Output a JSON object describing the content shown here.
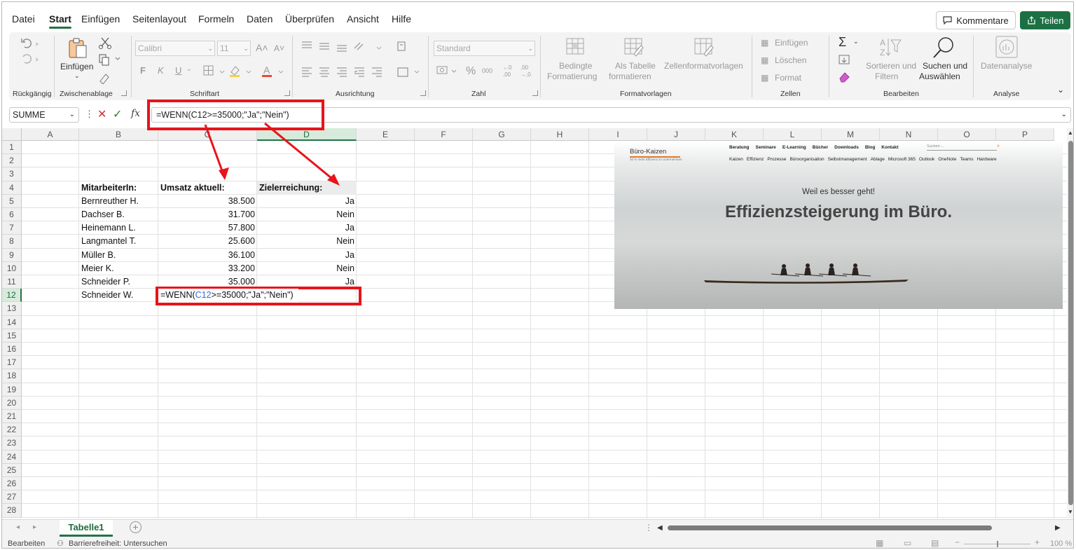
{
  "menu": {
    "tabs": [
      "Datei",
      "Start",
      "Einfügen",
      "Seitenlayout",
      "Formeln",
      "Daten",
      "Überprüfen",
      "Ansicht",
      "Hilfe"
    ],
    "active": "Start",
    "kommentare": "Kommentare",
    "teilen": "Teilen"
  },
  "ribbon": {
    "groups": {
      "undo": "Rückgängig",
      "clipboard": "Zwischenablage",
      "font": "Schriftart",
      "alignment": "Ausrichtung",
      "number": "Zahl",
      "styles": "Formatvorlagen",
      "cells": "Zellen",
      "editing": "Bearbeiten",
      "analysis": "Analyse"
    },
    "paste_label": "Einfügen",
    "font_name": "Calibri",
    "font_size": "11",
    "number_format": "Standard",
    "bold": "F",
    "italic": "K",
    "underline": "U",
    "cond_format_1": "Bedingte",
    "cond_format_2": "Formatierung",
    "as_table_1": "Als Tabelle",
    "as_table_2": "formatieren",
    "cell_styles": "Zellenformatvorlagen",
    "cells_insert": "Einfügen",
    "cells_delete": "Löschen",
    "cells_format": "Format",
    "sort_1": "Sortieren und",
    "sort_2": "Filtern",
    "find_1": "Suchen und",
    "find_2": "Auswählen",
    "analyze": "Datenanalyse"
  },
  "formula_bar": {
    "namebox": "SUMME",
    "formula": "=WENN(C12>=35000;\"Ja\";\"Nein\")",
    "fx": "fx"
  },
  "columns": [
    "A",
    "B",
    "C",
    "D",
    "E",
    "F",
    "G",
    "H",
    "I",
    "J",
    "K",
    "L",
    "M",
    "N",
    "O",
    "P"
  ],
  "rows": [
    "1",
    "2",
    "3",
    "4",
    "5",
    "6",
    "7",
    "8",
    "9",
    "10",
    "11",
    "12",
    "13",
    "14",
    "15",
    "16",
    "17",
    "18",
    "19",
    "20",
    "21",
    "22",
    "23",
    "24",
    "25",
    "26",
    "27",
    "28"
  ],
  "table": {
    "headers": [
      "MitarbeiterIn:",
      "Umsatz aktuell:",
      "Zielerreichung:"
    ],
    "rows": [
      [
        "Bernreuther H.",
        "38.500",
        "Ja"
      ],
      [
        "Dachser B.",
        "31.700",
        "Nein"
      ],
      [
        "Heinemann L.",
        "57.800",
        "Ja"
      ],
      [
        "Langmantel T.",
        "25.600",
        "Nein"
      ],
      [
        "Müller B.",
        "36.100",
        "Ja"
      ],
      [
        "Meier K.",
        "33.200",
        "Nein"
      ],
      [
        "Schneider P.",
        "35.000",
        "Ja"
      ],
      [
        "Schneider W.",
        "",
        ""
      ]
    ],
    "edit_prefix": "=WENN(",
    "edit_ref": "C12",
    "edit_suffix": ">=35000;\"Ja\";\"Nein\")"
  },
  "website": {
    "logo": "Büro-Kaizen",
    "logo_sub": "20 % mehr Effizienz im Unternehmen",
    "nav": [
      "Beratung",
      "Seminare",
      "E-Learning",
      "Bücher",
      "Downloads",
      "Blog",
      "Kontakt"
    ],
    "search": "Suchen ...",
    "subnav": [
      "Kaizen",
      "Effizienz",
      "Prozesse",
      "Büroorganisation",
      "Selbstmanagement",
      "Ablage",
      "Microsoft 365",
      "Outlook",
      "OneNote",
      "Teams",
      "Hardware"
    ],
    "tagline": "Weil es besser geht!",
    "headline": "Effizienzsteigerung im Büro."
  },
  "sheet": {
    "tab": "Tabelle1"
  },
  "status": {
    "mode": "Bearbeiten",
    "accessibility": "Barrierefreiheit: Untersuchen",
    "zoom": "100 %"
  },
  "colors": {
    "accent": "#217346",
    "highlight": "#e8141b"
  }
}
